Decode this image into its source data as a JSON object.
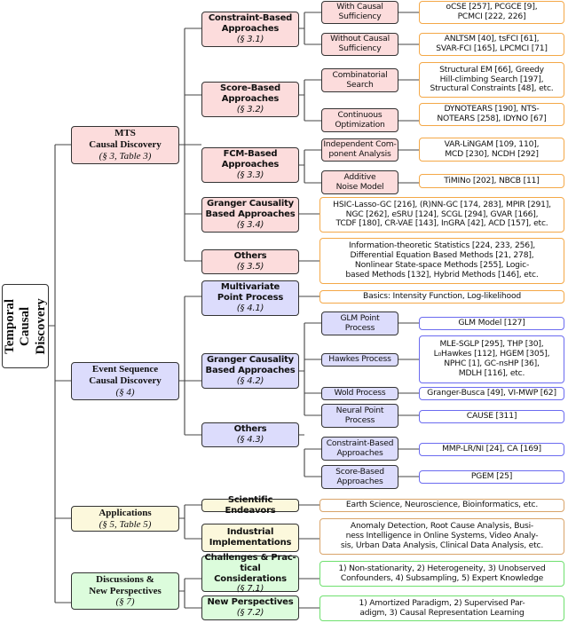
{
  "root": {
    "lines": [
      "Temporal",
      "Causal",
      "Discovery"
    ]
  },
  "mts": {
    "title_lines": [
      "MTS",
      "Causal Discovery"
    ],
    "section": "(§ 3, Table 3)",
    "constraint": {
      "lines": [
        "Constraint-Based",
        "Approaches"
      ],
      "section": "(§ 3.1)",
      "with": {
        "lines": [
          "With Causal",
          "Sufficiency"
        ],
        "leaf": [
          "oCSE [257], PCGCE [9],",
          "PCMCI [222, 226]"
        ]
      },
      "without": {
        "lines": [
          "Without Causal",
          "Sufficiency"
        ],
        "leaf": [
          "ANLTSM [40], tsFCI [61],",
          "SVAR-FCI [165], LPCMCI [71]"
        ]
      }
    },
    "score": {
      "lines": [
        "Score-Based",
        "Approaches"
      ],
      "section": "(§ 3.2)",
      "combinatorial": {
        "lines": [
          "Combinatorial",
          "Search"
        ],
        "leaf": [
          "Structural EM [66], Greedy",
          "Hill-climbing Search [197],",
          "Structural Constraints [48], etc."
        ]
      },
      "continuous": {
        "lines": [
          "Continuous",
          "Optimization"
        ],
        "leaf": [
          "DYNOTEARS [190], NTS-",
          "NOTEARS [258], IDYNO [67]"
        ]
      }
    },
    "fcm": {
      "lines": [
        "FCM-Based",
        "Approaches"
      ],
      "section": "(§ 3.3)",
      "ica": {
        "lines": [
          "Independent Com-",
          "ponent Analysis"
        ],
        "leaf": [
          "VAR-LiNGAM [109, 110],",
          "MCD [230], NCDH [292]"
        ]
      },
      "anm": {
        "lines": [
          "Additive",
          "Noise Model"
        ],
        "leaf": [
          "TiMINo [202], NBCB [11]"
        ]
      }
    },
    "granger": {
      "lines": [
        "Granger Causality",
        "Based Approaches"
      ],
      "section": "(§ 3.4)",
      "leaf": [
        "HSIC-Lasso-GC [216], (R)NN-GC [174, 283], MPIR [291],",
        "NGC [262], eSRU [124], SCGL [294], GVAR [166],",
        "TCDF [180], CR-VAE [143], InGRA [42], ACD [157], etc."
      ]
    },
    "others": {
      "lines": [
        "Others"
      ],
      "section": "(§ 3.5)",
      "leaf": [
        "Information-theoretic Statistics [224, 233, 256],",
        "Differential Equation Based Methods [21, 278],",
        "Nonlinear State-space Methods [255], Logic-",
        "based Methods [132], Hybrid Methods [146], etc."
      ]
    }
  },
  "event": {
    "title_lines": [
      "Event Sequence",
      "Causal Discovery"
    ],
    "section": "(§ 4)",
    "mpp": {
      "lines": [
        "Multivariate",
        "Point Process"
      ],
      "section": "(§ 4.1)",
      "leaf": [
        "Basics: Intensity Function, Log-likelihood"
      ]
    },
    "granger": {
      "lines": [
        "Granger Causality",
        "Based Approaches"
      ],
      "section": "(§ 4.2)",
      "glm": {
        "lines": [
          "GLM Point",
          "Process"
        ],
        "leaf": [
          "GLM Model [127]"
        ]
      },
      "hawkes": {
        "lines": [
          "Hawkes Process"
        ],
        "leaf": [
          "MLE-SGLP [295], THP [30],",
          "L₀Hawkes [112], HGEM [305],",
          "NPHC [1], GC-nsHP [36],",
          "MDLH [116], etc."
        ]
      },
      "wold": {
        "lines": [
          "Wold Process"
        ],
        "leaf": [
          "Granger-Busca [49], VI-MWP [62]"
        ]
      },
      "neural": {
        "lines": [
          "Neural Point",
          "Process"
        ],
        "leaf": [
          "CAUSE [311]"
        ]
      }
    },
    "others": {
      "lines": [
        "Others"
      ],
      "section": "(§ 4.3)",
      "constraint": {
        "lines": [
          "Constraint-Based",
          "Approaches"
        ],
        "leaf": [
          "MMP-LR/NI [24], CA [169]"
        ]
      },
      "score": {
        "lines": [
          "Score-Based",
          "Approaches"
        ],
        "leaf": [
          "PGEM [25]"
        ]
      }
    }
  },
  "applications": {
    "title_lines": [
      "Applications"
    ],
    "section": "(§ 5, Table 5)",
    "scientific": {
      "lines": [
        "Scientific Endeavors"
      ],
      "leaf": [
        "Earth Science, Neuroscience, Bioinformatics, etc."
      ]
    },
    "industrial": {
      "lines": [
        "Industrial",
        "Implementations"
      ],
      "leaf": [
        "Anomaly Detection, Root Cause Analysis, Busi-",
        "ness Intelligence in Online Systems, Video Analy-",
        "sis, Urban Data Analysis, Clinical Data Analysis, etc."
      ]
    }
  },
  "discussions": {
    "title_lines": [
      "Discussions &",
      "New Perspectives"
    ],
    "section": "(§ 7)",
    "challenges": {
      "lines": [
        "Challenges & Prac-",
        "tical Considerations"
      ],
      "section": "(§ 7.1)",
      "leaf": [
        "1) Non-stationarity, 2) Heterogeneity, 3) Unobserved",
        "Confounders, 4) Subsampling, 5) Expert Knowledge"
      ]
    },
    "perspectives": {
      "lines": [
        "New Perspectives"
      ],
      "section": "(§ 7.2)",
      "leaf": [
        "1) Amortized Paradigm, 2) Supervised Par-",
        "adigm, 3) Causal Representation Learning"
      ]
    }
  },
  "colors": {
    "mts": "#fcdcdc",
    "event": "#dcdcfc",
    "applications": "#fcf8dc",
    "discussions": "#dcfcdc",
    "leaf_orange": "#f4a847",
    "leaf_blue": "#6b6bf0",
    "leaf_tan": "#d9a46a",
    "leaf_green": "#6fe06f"
  }
}
